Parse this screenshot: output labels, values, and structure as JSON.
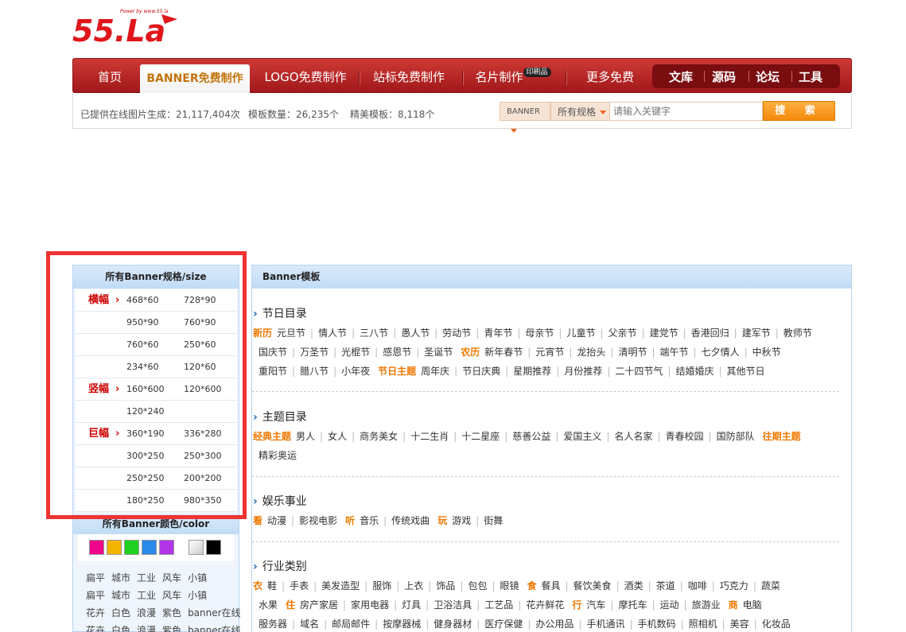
{
  "logo": {
    "text": "55.La",
    "tagline": "Power by www.55.la"
  },
  "nav": {
    "items": [
      "首页",
      "BANNER免费制作",
      "LOGO免费制作",
      "站标免费制作",
      "名片制作",
      "更多免费"
    ],
    "badge": "印刷品",
    "right": [
      "文库",
      "源码",
      "论坛",
      "工具"
    ]
  },
  "stats": {
    "generated": "已提供在线图片生成：21,117,404次",
    "templates": "模板数量：26,235个",
    "featured": "精美模板：8,118个"
  },
  "search": {
    "type": "BANNER",
    "size": "所有规格",
    "placeholder": "请输入关键字",
    "button": "搜 索"
  },
  "sidebar": {
    "title": "所有Banner规格/size",
    "rows": [
      {
        "cat": "横幅",
        "v1": "468*60",
        "v2": "728*90"
      },
      {
        "cat": "",
        "v1": "950*90",
        "v2": "760*90"
      },
      {
        "cat": "",
        "v1": "760*60",
        "v2": "250*60"
      },
      {
        "cat": "",
        "v1": "234*60",
        "v2": "120*60"
      },
      {
        "cat": "竖幅",
        "v1": "160*600",
        "v2": "120*600"
      },
      {
        "cat": "",
        "v1": "120*240",
        "v2": ""
      },
      {
        "cat": "巨幅",
        "v1": "360*190",
        "v2": "336*280"
      },
      {
        "cat": "",
        "v1": "300*250",
        "v2": "250*300"
      },
      {
        "cat": "",
        "v1": "250*250",
        "v2": "200*200"
      },
      {
        "cat": "",
        "v1": "180*250",
        "v2": "980*350"
      }
    ],
    "color_title": "所有Banner颜色/color",
    "colors": [
      "#f0068c",
      "#f3b400",
      "#20d020",
      "#2a8ae8",
      "#b235e8",
      "#f4f4f4",
      "#000000"
    ],
    "tag_rows": [
      [
        "扁平",
        "城市",
        "工业",
        "风车",
        "小镇"
      ],
      [
        "扁平",
        "城市",
        "工业",
        "风车",
        "小镇"
      ],
      [
        "花卉",
        "白色",
        "浪漫",
        "紫色",
        "banner在线"
      ],
      [
        "花卉",
        "白色",
        "浪漫",
        "紫色",
        "banner在线"
      ]
    ]
  },
  "main": {
    "title": "Banner模板",
    "sections": [
      {
        "title": "节日目录",
        "lines": [
          [
            {
              "label": "新历"
            },
            "元旦节",
            "情人节",
            "三八节",
            "愚人节",
            "劳动节",
            "青年节",
            "母亲节",
            "儿童节",
            "父亲节",
            "建党节",
            "香港回归",
            "建军节",
            "教师节"
          ],
          [
            "国庆节",
            "万圣节",
            "光棍节",
            "感恩节",
            "圣诞节",
            {
              "label": "农历"
            },
            "新年春节",
            "元宵节",
            "龙抬头",
            "清明节",
            "端午节",
            "七夕情人",
            "中秋节"
          ],
          [
            "重阳节",
            "腊八节",
            "小年夜",
            {
              "label": "节日主题"
            },
            "周年庆",
            "节日庆典",
            "星期推荐",
            "月份推荐",
            "二十四节气",
            "结婚婚庆",
            "其他节日"
          ]
        ]
      },
      {
        "title": "主题目录",
        "lines": [
          [
            {
              "label": "经典主题"
            },
            "男人",
            "女人",
            "商务美女",
            "十二生肖",
            "十二星座",
            "慈善公益",
            "爱国主义",
            "名人名家",
            "青春校园",
            "国防部队",
            {
              "label": "往期主题"
            }
          ],
          [
            "精彩奥运"
          ]
        ]
      },
      {
        "title": "娱乐事业",
        "lines": [
          [
            {
              "label": "看"
            },
            "动漫",
            "影视电影",
            {
              "label": "听"
            },
            "音乐",
            "传统戏曲",
            {
              "label": "玩"
            },
            "游戏",
            "街舞"
          ]
        ]
      },
      {
        "title": "行业类别",
        "lines": [
          [
            {
              "label": "衣"
            },
            "鞋",
            "手表",
            "美发造型",
            "服饰",
            "上衣",
            "饰品",
            "包包",
            "眼镜",
            {
              "label": "食"
            },
            "餐具",
            "餐饮美食",
            "酒类",
            "茶道",
            "咖啡",
            "巧克力",
            "蔬菜"
          ],
          [
            "水果",
            {
              "label": "住"
            },
            "房产家居",
            "家用电器",
            "灯具",
            "卫浴洁具",
            "工艺品",
            "花卉鲜花",
            {
              "label": "行"
            },
            "汽车",
            "摩托车",
            "运动",
            "旅游业",
            {
              "label": "商"
            },
            "电脑"
          ],
          [
            "服务器",
            "域名",
            "邮局邮件",
            "按摩器械",
            "健身器材",
            "医疗保健",
            "办公用品",
            "手机通讯",
            "手机数码",
            "照相机",
            "美容",
            "化妆品"
          ]
        ]
      }
    ]
  }
}
